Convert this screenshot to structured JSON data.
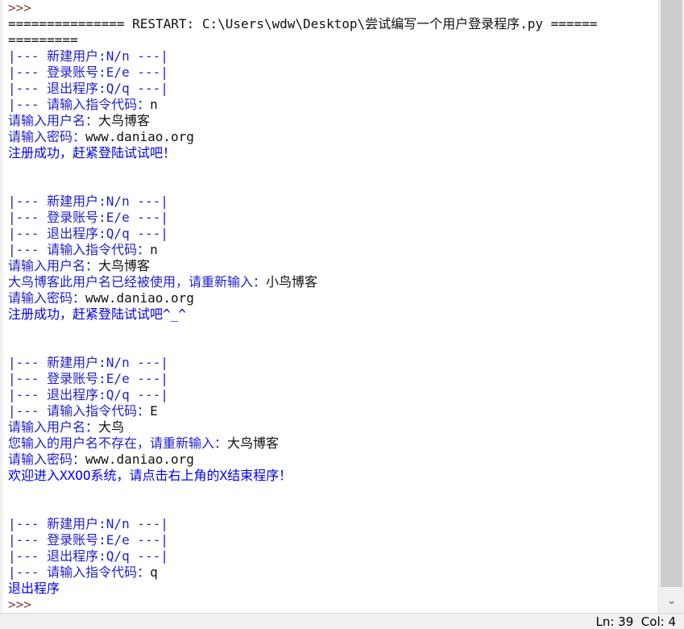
{
  "console": {
    "lines": [
      {
        "segments": [
          {
            "text": ">>>",
            "color": "prompt"
          }
        ]
      },
      {
        "segments": [
          {
            "text": "=============== RESTART: C:\\Users\\wdw\\Desktop\\尝试编写一个用户登录程序.py ======",
            "color": "black"
          }
        ]
      },
      {
        "segments": [
          {
            "text": "=========",
            "color": "black"
          }
        ]
      },
      {
        "segments": [
          {
            "text": "|--- 新建用户:N/n ---|",
            "color": "blue"
          }
        ]
      },
      {
        "segments": [
          {
            "text": "|--- 登录账号:E/e ---|",
            "color": "blue"
          }
        ]
      },
      {
        "segments": [
          {
            "text": "|--- 退出程序:Q/q ---|",
            "color": "blue"
          }
        ]
      },
      {
        "segments": [
          {
            "text": "|--- 请输入指令代码：",
            "color": "blue"
          },
          {
            "text": "n",
            "color": "black"
          }
        ]
      },
      {
        "segments": [
          {
            "text": "请输入用户名：",
            "color": "blue"
          },
          {
            "text": "大鸟博客",
            "color": "black"
          }
        ]
      },
      {
        "segments": [
          {
            "text": "请输入密码：",
            "color": "blue"
          },
          {
            "text": "www.daniao.org",
            "color": "black"
          }
        ]
      },
      {
        "segments": [
          {
            "text": "注册成功，赶紧登陆试试吧！",
            "color": "out"
          }
        ]
      },
      {
        "segments": [
          {
            "text": "",
            "color": "black"
          }
        ]
      },
      {
        "segments": [
          {
            "text": "",
            "color": "black"
          }
        ]
      },
      {
        "segments": [
          {
            "text": "|--- 新建用户:N/n ---|",
            "color": "blue"
          }
        ]
      },
      {
        "segments": [
          {
            "text": "|--- 登录账号:E/e ---|",
            "color": "blue"
          }
        ]
      },
      {
        "segments": [
          {
            "text": "|--- 退出程序:Q/q ---|",
            "color": "blue"
          }
        ]
      },
      {
        "segments": [
          {
            "text": "|--- 请输入指令代码：",
            "color": "blue"
          },
          {
            "text": "n",
            "color": "black"
          }
        ]
      },
      {
        "segments": [
          {
            "text": "请输入用户名：",
            "color": "blue"
          },
          {
            "text": "大鸟博客",
            "color": "black"
          }
        ]
      },
      {
        "segments": [
          {
            "text": "大鸟博客此用户名已经被使用，请重新输入：",
            "color": "blue"
          },
          {
            "text": "小鸟博客",
            "color": "black"
          }
        ]
      },
      {
        "segments": [
          {
            "text": "请输入密码：",
            "color": "blue"
          },
          {
            "text": "www.daniao.org",
            "color": "black"
          }
        ]
      },
      {
        "segments": [
          {
            "text": "注册成功，赶紧登陆试试吧^_^",
            "color": "out"
          }
        ]
      },
      {
        "segments": [
          {
            "text": "",
            "color": "black"
          }
        ]
      },
      {
        "segments": [
          {
            "text": "",
            "color": "black"
          }
        ]
      },
      {
        "segments": [
          {
            "text": "|--- 新建用户:N/n ---|",
            "color": "blue"
          }
        ]
      },
      {
        "segments": [
          {
            "text": "|--- 登录账号:E/e ---|",
            "color": "blue"
          }
        ]
      },
      {
        "segments": [
          {
            "text": "|--- 退出程序:Q/q ---|",
            "color": "blue"
          }
        ]
      },
      {
        "segments": [
          {
            "text": "|--- 请输入指令代码：",
            "color": "blue"
          },
          {
            "text": "E",
            "color": "black"
          }
        ]
      },
      {
        "segments": [
          {
            "text": "请输入用户名：",
            "color": "blue"
          },
          {
            "text": "大鸟",
            "color": "black"
          }
        ]
      },
      {
        "segments": [
          {
            "text": "您输入的用户名不存在，请重新输入：",
            "color": "blue"
          },
          {
            "text": "大鸟博客",
            "color": "black"
          }
        ]
      },
      {
        "segments": [
          {
            "text": "请输入密码：",
            "color": "blue"
          },
          {
            "text": "www.daniao.org",
            "color": "black"
          }
        ]
      },
      {
        "segments": [
          {
            "text": "欢迎进入XXOO系统，请点击右上角的X结束程序！",
            "color": "out"
          }
        ]
      },
      {
        "segments": [
          {
            "text": "",
            "color": "black"
          }
        ]
      },
      {
        "segments": [
          {
            "text": "",
            "color": "black"
          }
        ]
      },
      {
        "segments": [
          {
            "text": "|--- 新建用户:N/n ---|",
            "color": "blue"
          }
        ]
      },
      {
        "segments": [
          {
            "text": "|--- 登录账号:E/e ---|",
            "color": "blue"
          }
        ]
      },
      {
        "segments": [
          {
            "text": "|--- 退出程序:Q/q ---|",
            "color": "blue"
          }
        ]
      },
      {
        "segments": [
          {
            "text": "|--- 请输入指令代码：",
            "color": "blue"
          },
          {
            "text": "q",
            "color": "black"
          }
        ]
      },
      {
        "segments": [
          {
            "text": "退出程序",
            "color": "out"
          }
        ]
      },
      {
        "segments": [
          {
            "text": ">>>",
            "color": "prompt"
          }
        ]
      }
    ]
  },
  "status": {
    "position": "Ln: 39  Col: 4"
  },
  "scrollbar": {
    "down_arrow": "⌄"
  },
  "colors": {
    "black": "#111111",
    "blue": "#1f1fd0",
    "prompt": "#8a3a3a",
    "out": "#0000ee"
  }
}
